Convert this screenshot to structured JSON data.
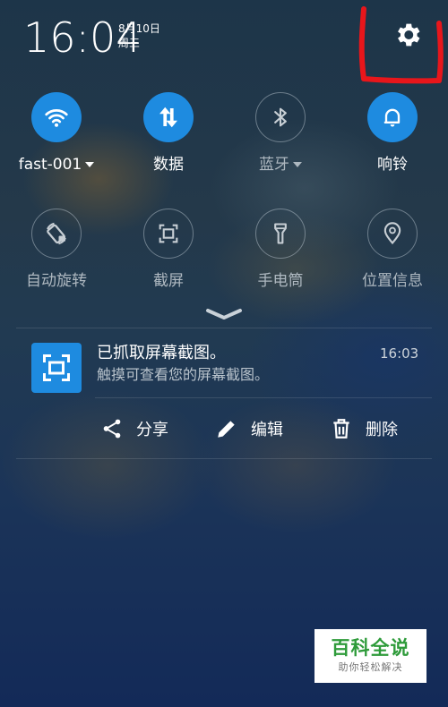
{
  "header": {
    "time": "16:04",
    "date": "8月10日",
    "weekday": "周三"
  },
  "toggles": [
    {
      "label": "fast-001",
      "icon": "wifi-icon",
      "state": "on",
      "dropdown": true
    },
    {
      "label": "数据",
      "icon": "data-icon",
      "state": "on",
      "dropdown": false
    },
    {
      "label": "蓝牙",
      "icon": "bluetooth-icon",
      "state": "off",
      "dropdown": true
    },
    {
      "label": "响铃",
      "icon": "bell-icon",
      "state": "on",
      "dropdown": false
    },
    {
      "label": "自动旋转",
      "icon": "rotate-icon",
      "state": "off",
      "dropdown": false
    },
    {
      "label": "截屏",
      "icon": "screenshot-icon",
      "state": "off",
      "dropdown": false
    },
    {
      "label": "手电筒",
      "icon": "flashlight-icon",
      "state": "off",
      "dropdown": false
    },
    {
      "label": "位置信息",
      "icon": "location-icon",
      "state": "off",
      "dropdown": false
    }
  ],
  "notification": {
    "title": "已抓取屏幕截图。",
    "subtitle": "触摸可查看您的屏幕截图。",
    "time": "16:03",
    "actions": {
      "share": "分享",
      "edit": "编辑",
      "delete": "删除"
    }
  },
  "watermark": {
    "main": "百科全说",
    "sub": "助你轻松解决"
  },
  "colors": {
    "accent": "#1e8be0",
    "annotation": "#e8161b",
    "watermark_green": "#2e9b3a"
  }
}
